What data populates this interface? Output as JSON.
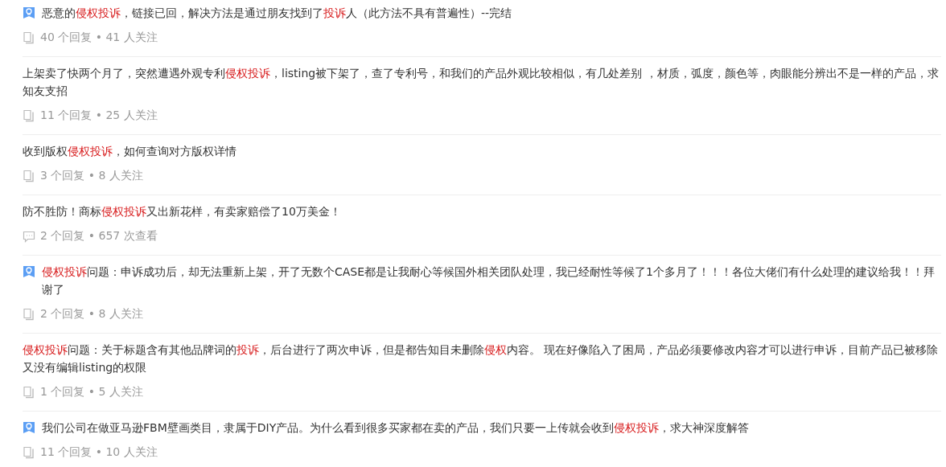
{
  "questions": [
    {
      "badge": true,
      "title": [
        {
          "text": "恶意的",
          "highlight": false
        },
        {
          "text": "侵权投诉",
          "highlight": true
        },
        {
          "text": "，链接已回，解决方法是通过朋友找到了",
          "highlight": false
        },
        {
          "text": "投诉",
          "highlight": true
        },
        {
          "text": "人（此方法不具有普遍性）--完结",
          "highlight": false
        }
      ],
      "kind": "replies",
      "meta": "40 个回复 • 41 人关注"
    },
    {
      "badge": false,
      "title": [
        {
          "text": "上架卖了快两个月了，突然遭遇外观专利",
          "highlight": false
        },
        {
          "text": "侵权投诉",
          "highlight": true
        },
        {
          "text": "，listing被下架了，查了专利号，和我们的产品外观比较相似，有几处差别 ，材质，弧度，颜色等，肉眼能分辨出不是一样的产品，求知友支招",
          "highlight": false
        }
      ],
      "kind": "replies",
      "meta": "11 个回复 • 25 人关注"
    },
    {
      "badge": false,
      "title": [
        {
          "text": "收到版权",
          "highlight": false
        },
        {
          "text": "侵权投诉",
          "highlight": true
        },
        {
          "text": "，如何查询对方版权详情",
          "highlight": false
        }
      ],
      "kind": "replies",
      "meta": "3 个回复 • 8 人关注"
    },
    {
      "badge": false,
      "title": [
        {
          "text": "防不胜防！商标",
          "highlight": false
        },
        {
          "text": "侵权投诉",
          "highlight": true
        },
        {
          "text": "又出新花样，有卖家赔偿了10万美金！",
          "highlight": false
        }
      ],
      "kind": "views",
      "meta": "2 个回复 • 657 次查看"
    },
    {
      "badge": true,
      "title": [
        {
          "text": "侵权投诉",
          "highlight": true
        },
        {
          "text": "问题：申诉成功后，却无法重新上架，开了无数个CASE都是让我耐心等候国外相关团队处理，我已经耐性等候了1个多月了！！！各位大佬们有什么处理的建议给我！！拜谢了",
          "highlight": false
        }
      ],
      "kind": "replies",
      "meta": "2 个回复 • 8 人关注"
    },
    {
      "badge": false,
      "title": [
        {
          "text": "侵权投诉",
          "highlight": true
        },
        {
          "text": "问题：关于标题含有其他品牌词的",
          "highlight": false
        },
        {
          "text": "投诉",
          "highlight": true
        },
        {
          "text": "，后台进行了两次申诉，但是都告知目未删除",
          "highlight": false
        },
        {
          "text": "侵权",
          "highlight": true
        },
        {
          "text": "内容。 现在好像陷入了困局，产品必须要修改内容才可以进行申诉，目前产品已被移除又没有编辑listing的权限",
          "highlight": false
        }
      ],
      "kind": "replies",
      "meta": "1 个回复 • 5 人关注"
    },
    {
      "badge": true,
      "title": [
        {
          "text": "我们公司在做亚马逊FBM壁画类目，隶属于DIY产品。为什么看到很多买家都在卖的产品，我们只要一上传就会收到",
          "highlight": false
        },
        {
          "text": "侵权投诉",
          "highlight": true
        },
        {
          "text": "，求大神深度解答",
          "highlight": false
        }
      ],
      "kind": "replies",
      "meta": "11 个回复 • 10 人关注"
    }
  ]
}
